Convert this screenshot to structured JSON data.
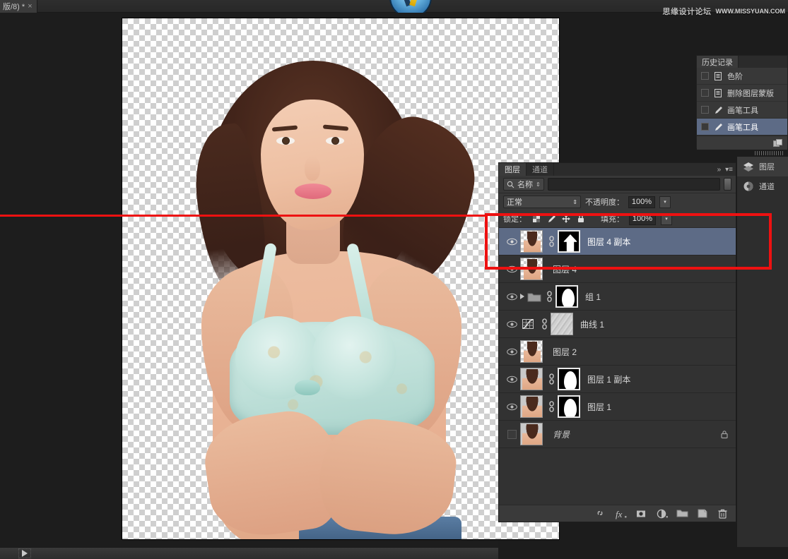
{
  "app": {
    "document_tab": "版/8) *",
    "close_glyph": "×"
  },
  "watermark": {
    "cn": "思缘设计论坛",
    "en": "WWW.MISSYUAN.COM"
  },
  "history_panel": {
    "tab": "历史记录",
    "rows": [
      {
        "label": "色阶",
        "icon": "document-icon",
        "selected": false
      },
      {
        "label": "删除图层蒙版",
        "icon": "document-icon",
        "selected": false
      },
      {
        "label": "画笔工具",
        "icon": "brush-icon",
        "selected": false
      },
      {
        "label": "画笔工具",
        "icon": "brush-icon",
        "selected": true
      }
    ],
    "footer_icons": [
      "new-snapshot-icon"
    ]
  },
  "dock": {
    "items": [
      {
        "label": "图层",
        "icon": "layers-icon",
        "active": true
      },
      {
        "label": "通道",
        "icon": "channels-icon",
        "active": false
      }
    ]
  },
  "layers_panel": {
    "tabs": [
      {
        "label": "图层",
        "active": true
      },
      {
        "label": "通道",
        "active": false
      }
    ],
    "collapse_glyph": "»",
    "menu_glyph": "▾≡",
    "filter": {
      "type_label": "名称",
      "search_icon": "search-icon",
      "stepper_glyph": "⇕",
      "value": "",
      "placeholder": ""
    },
    "blend": {
      "mode": "正常",
      "mode_stepper": "⇕",
      "opacity_label": "不透明度：",
      "opacity_value": "100%",
      "opacity_arrow": "▾"
    },
    "lock": {
      "label": "锁定：",
      "icons": [
        "lock-transparent-icon",
        "lock-image-icon",
        "lock-position-icon",
        "lock-all-icon"
      ],
      "fill_label": "填充：",
      "fill_value": "100%",
      "fill_arrow": "▾"
    },
    "rows": [
      {
        "name": "图层 4 副本",
        "visible": true,
        "selected": true,
        "kind": "pixel-with-mask",
        "has_link": true,
        "has_mask": true,
        "mask_style": "arrow",
        "locked": false
      },
      {
        "name": "图层 4",
        "visible": true,
        "selected": false,
        "kind": "pixel",
        "has_link": false,
        "has_mask": false,
        "locked": false
      },
      {
        "name": "组 1",
        "visible": true,
        "selected": false,
        "kind": "group",
        "has_link": true,
        "has_mask": true,
        "mask_style": "figure",
        "expanded": false,
        "locked": false
      },
      {
        "name": "曲线 1",
        "visible": true,
        "selected": false,
        "kind": "adjustment-curves",
        "has_link": true,
        "has_mask": true,
        "mask_style": "noise",
        "locked": false
      },
      {
        "name": "图层 2",
        "visible": true,
        "selected": false,
        "kind": "pixel",
        "has_link": false,
        "has_mask": false,
        "locked": false
      },
      {
        "name": "图层 1 副本",
        "visible": true,
        "selected": false,
        "kind": "pixel-with-mask",
        "has_link": true,
        "has_mask": true,
        "mask_style": "figure",
        "locked": false
      },
      {
        "name": "图层 1",
        "visible": true,
        "selected": false,
        "kind": "pixel-with-mask",
        "has_link": true,
        "has_mask": true,
        "mask_style": "figure",
        "locked": false
      },
      {
        "name": "背景",
        "visible": false,
        "selected": false,
        "kind": "background",
        "has_link": false,
        "has_mask": false,
        "locked": true
      }
    ],
    "footer_icons": [
      "link-layers-icon",
      "layer-style-fx-icon",
      "add-mask-icon",
      "new-adjustment-icon",
      "new-group-icon",
      "new-layer-icon",
      "delete-layer-icon"
    ]
  },
  "statusbar": {
    "play_icon": "play-icon"
  },
  "annotation": {
    "highlight_color": "#ee1111",
    "target": "图层 4 副本"
  }
}
